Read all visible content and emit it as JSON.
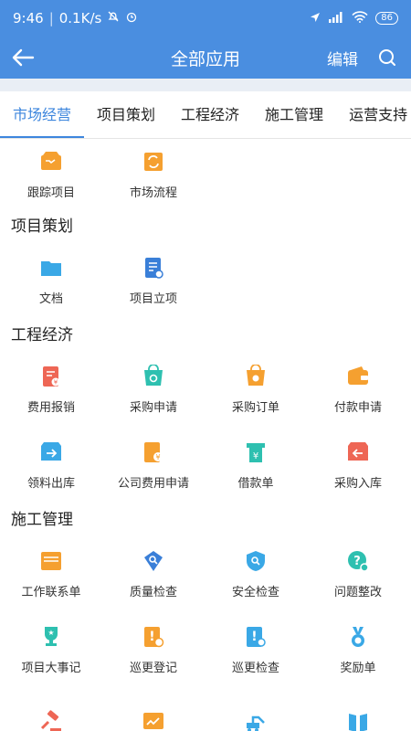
{
  "status": {
    "time": "9:46",
    "speed": "0.1K/s",
    "battery": "86"
  },
  "header": {
    "title": "全部应用",
    "edit": "编辑"
  },
  "tabs": [
    "市场经营",
    "项目策划",
    "工程经济",
    "施工管理",
    "运营支持"
  ],
  "sections": [
    {
      "title": "",
      "items": [
        {
          "label": "跟踪项目",
          "icon": "tracking-project-icon",
          "color": "#f5a030"
        },
        {
          "label": "市场流程",
          "icon": "market-process-icon",
          "color": "#f5a030"
        }
      ]
    },
    {
      "title": "项目策划",
      "items": [
        {
          "label": "文档",
          "icon": "folder-icon",
          "color": "#3aa8e6"
        },
        {
          "label": "项目立项",
          "icon": "project-setup-icon",
          "color": "#3a7fd8"
        }
      ]
    },
    {
      "title": "工程经济",
      "items": [
        {
          "label": "费用报销",
          "icon": "expense-icon",
          "color": "#ee6655"
        },
        {
          "label": "采购申请",
          "icon": "purchase-request-icon",
          "color": "#2ec0b0"
        },
        {
          "label": "采购订单",
          "icon": "purchase-order-icon",
          "color": "#f5a030"
        },
        {
          "label": "付款申请",
          "icon": "wallet-icon",
          "color": "#f5a030"
        },
        {
          "label": "领料出库",
          "icon": "outbound-icon",
          "color": "#3aa8e6"
        },
        {
          "label": "公司费用申请",
          "icon": "company-expense-icon",
          "color": "#f5a030"
        },
        {
          "label": "借款单",
          "icon": "loan-icon",
          "color": "#2ec0b0"
        },
        {
          "label": "采购入库",
          "icon": "inbound-icon",
          "color": "#ee6655"
        }
      ]
    },
    {
      "title": "施工管理",
      "items": [
        {
          "label": "工作联系单",
          "icon": "contact-sheet-icon",
          "color": "#f5a030"
        },
        {
          "label": "质量检查",
          "icon": "quality-check-icon",
          "color": "#3a7fd8"
        },
        {
          "label": "安全检查",
          "icon": "safety-check-icon",
          "color": "#3aa8e6"
        },
        {
          "label": "问题整改",
          "icon": "question-icon",
          "color": "#2ec0b0"
        },
        {
          "label": "项目大事记",
          "icon": "trophy-icon",
          "color": "#2ec0b0"
        },
        {
          "label": "巡更登记",
          "icon": "patrol-register-icon",
          "color": "#f5a030"
        },
        {
          "label": "巡更检查",
          "icon": "patrol-check-icon",
          "color": "#3aa8e6"
        },
        {
          "label": "奖励单",
          "icon": "medal-icon",
          "color": "#3aa8e6"
        },
        {
          "label": "",
          "icon": "gavel-icon",
          "color": "#ee6655"
        },
        {
          "label": "",
          "icon": "chart-board-icon",
          "color": "#f5a030"
        },
        {
          "label": "",
          "icon": "excavator-icon",
          "color": "#3aa8e6"
        },
        {
          "label": "",
          "icon": "book-icon",
          "color": "#3aa8e6"
        }
      ]
    }
  ]
}
